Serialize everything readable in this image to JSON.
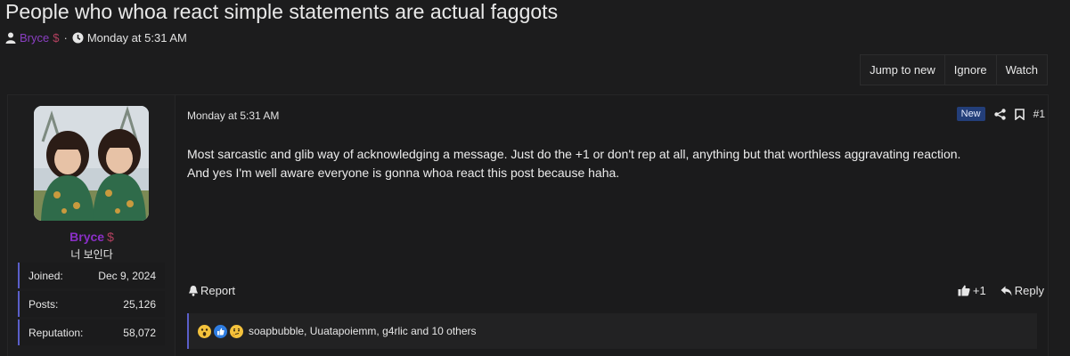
{
  "thread": {
    "title": "People who whoa react simple statements are actual faggots",
    "author": "Bryce",
    "author_badge": "$",
    "separator": "·",
    "date": "Monday at 5:31 AM"
  },
  "thread_actions": {
    "jump_to_new": "Jump to new",
    "ignore": "Ignore",
    "watch": "Watch"
  },
  "user": {
    "username": "Bryce",
    "badge": "$",
    "title": "너 보인다",
    "stats": [
      {
        "label": "Joined:",
        "value": "Dec 9, 2024"
      },
      {
        "label": "Posts:",
        "value": "25,126"
      },
      {
        "label": "Reputation:",
        "value": "58,072"
      }
    ]
  },
  "post": {
    "date": "Monday at 5:31 AM",
    "new_badge": "New",
    "number": "#1",
    "body": [
      "Most sarcastic and glib way of acknowledging a message. Just do the +1 or don't rep at all, anything but that worthless aggravating reaction.",
      "And yes I'm well aware everyone is gonna whoa react this post because haha."
    ],
    "report": "Report",
    "plus_one": "+1",
    "reply": "Reply",
    "reactions_text": "soapbubble, Uuatapoiemm, g4rlic and 10 others"
  },
  "colors": {
    "accent": "#5a5fc9",
    "username": "#8a2fc7",
    "new_badge": "#233e79"
  },
  "icons": [
    "user-icon",
    "clock-icon",
    "share-icon",
    "bookmark-icon",
    "bell-icon",
    "thumbs-up-icon",
    "reply-icon",
    "wow-emoji-icon",
    "like-emoji-icon",
    "thinking-emoji-icon"
  ]
}
